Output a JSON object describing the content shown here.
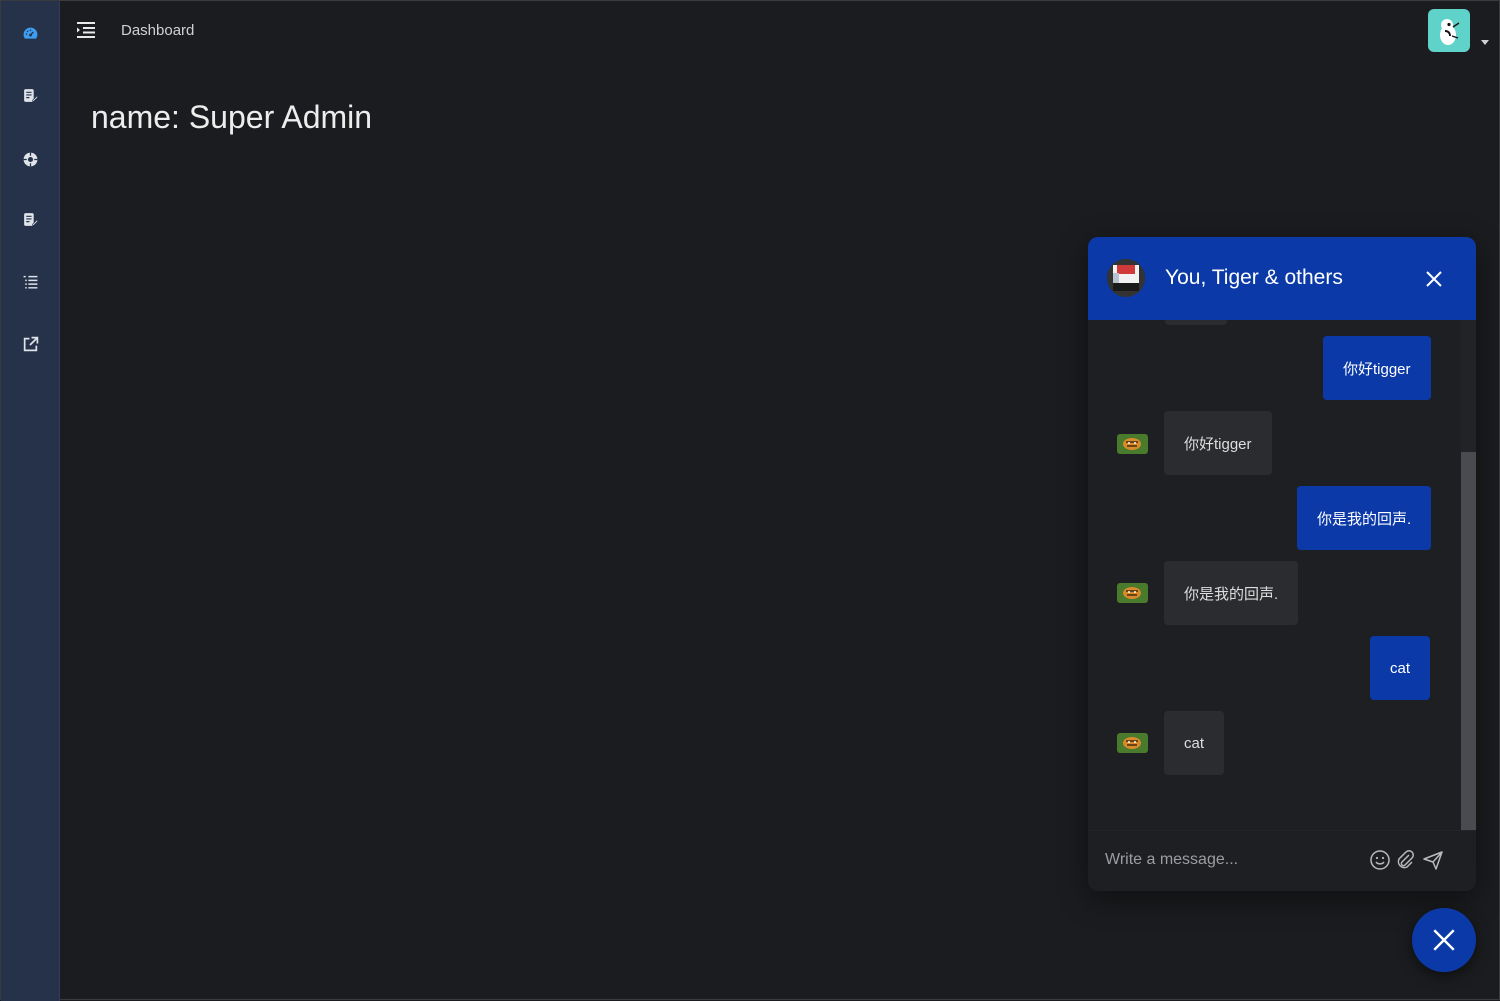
{
  "header": {
    "breadcrumb": "Dashboard",
    "menu_icon": "menu-fold-icon",
    "avatar_icon": "user-avatar-icon",
    "dropdown_icon": "caret-down-icon"
  },
  "sidebar": {
    "items": [
      {
        "name": "dashboard",
        "icon": "dashboard-gauge-icon",
        "active": true
      },
      {
        "name": "forms",
        "icon": "document-edit-icon"
      },
      {
        "name": "components",
        "icon": "component-circle-icon"
      },
      {
        "name": "pages",
        "icon": "document-edit-icon"
      },
      {
        "name": "list",
        "icon": "list-icon"
      },
      {
        "name": "external",
        "icon": "external-link-icon"
      }
    ]
  },
  "main": {
    "title": "name: Super Admin"
  },
  "chat": {
    "title": "You, Tiger & others",
    "messages": [
      {
        "from": "me",
        "text": "你好tigger"
      },
      {
        "from": "tiger",
        "text": "你好tigger"
      },
      {
        "from": "me",
        "text": "你是我的回声."
      },
      {
        "from": "tiger",
        "text": "你是我的回声."
      },
      {
        "from": "me",
        "text": "cat"
      },
      {
        "from": "tiger",
        "text": "cat"
      }
    ],
    "composer": {
      "placeholder": "Write a message...",
      "value": ""
    }
  },
  "colors": {
    "accent": "#0b3aa8",
    "sidebar": "#25324a",
    "background": "#1b1c1f",
    "active_icon": "#3d9df0"
  }
}
